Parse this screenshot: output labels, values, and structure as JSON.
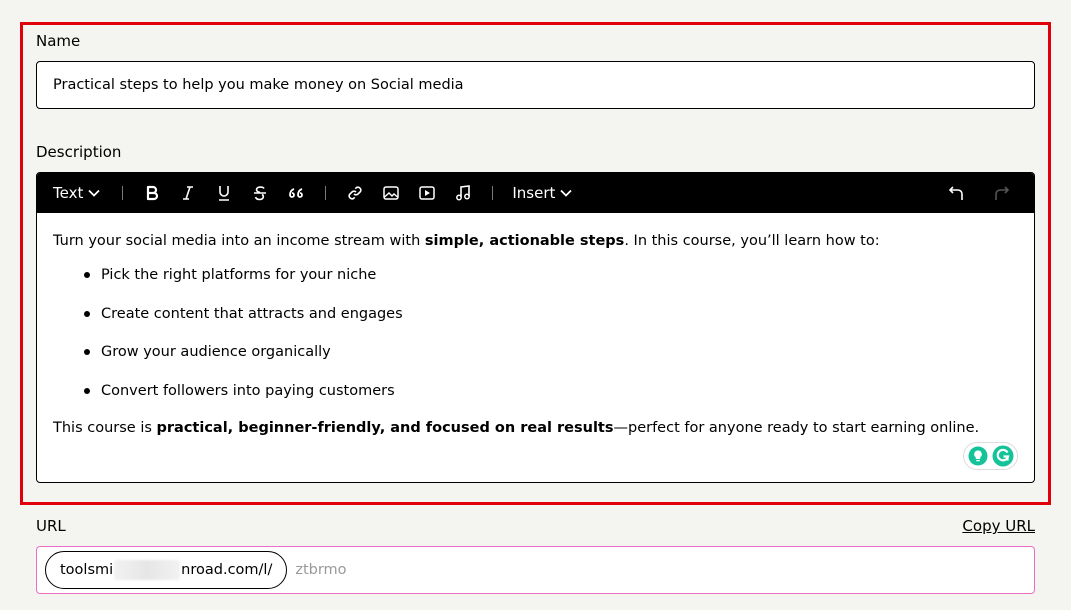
{
  "name": {
    "label": "Name",
    "value": "Practical steps to help you make money on Social media"
  },
  "description": {
    "label": "Description",
    "toolbar": {
      "text_dropdown": "Text",
      "insert_dropdown": "Insert",
      "buttons": [
        "bold-icon",
        "italic-icon",
        "underline-icon",
        "strikethrough-icon",
        "quote-icon",
        "link-icon",
        "image-icon",
        "video-icon",
        "music-icon",
        "undo-icon",
        "redo-icon"
      ]
    },
    "content": {
      "intro_before": "Turn your social media into an income stream with ",
      "intro_bold": "simple, actionable steps",
      "intro_after": ". In this course, you’ll learn how to:",
      "bullets": [
        "Pick the right platforms for your niche",
        "Create content that attracts and engages",
        "Grow your audience organically",
        "Convert followers into paying customers"
      ],
      "outro_before": "This course is ",
      "outro_bold": "practical, beginner-friendly, and focused on real results",
      "outro_after": "—perfect for anyone ready to start earning online."
    }
  },
  "url": {
    "label": "URL",
    "copy_label": "Copy URL",
    "prefix_start": "toolsmi",
    "prefix_end": "nroad.com/l/",
    "placeholder": "ztbrmo"
  },
  "colors": {
    "highlight": "#e0000b",
    "url_focus": "#e86fc4",
    "toolbar_bg": "#000000",
    "grammarly": "#15c39a"
  }
}
